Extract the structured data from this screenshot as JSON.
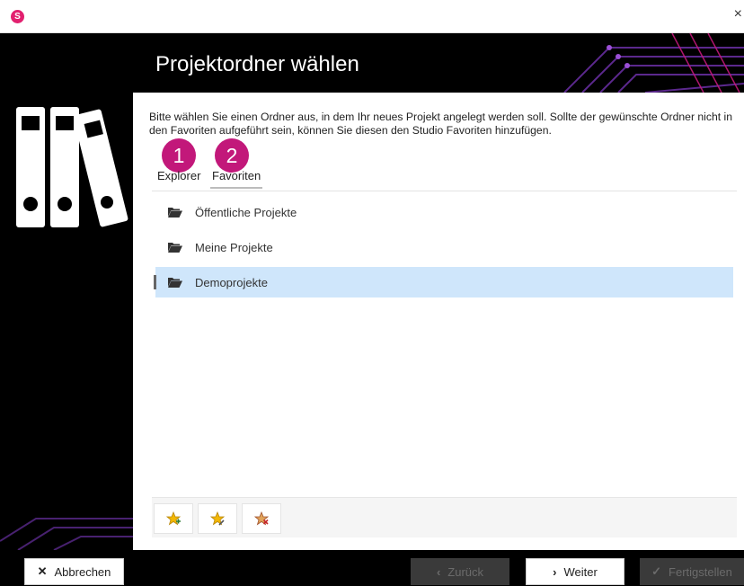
{
  "titlebar": {
    "close_glyph": "×"
  },
  "app_logo": {
    "letter": "S",
    "color": "#e2206f"
  },
  "header": {
    "title": "Projektordner wählen"
  },
  "instructions": "Bitte wählen Sie einen Ordner aus, in dem Ihr neues Projekt angelegt werden soll. Sollte der gewünschte Ordner nicht in den Favoriten aufgeführt sein, können Sie diesen den Studio Favoriten hinzufügen.",
  "badges": [
    "1",
    "2"
  ],
  "tabs": [
    {
      "label": "Explorer",
      "active": false
    },
    {
      "label": "Favoriten",
      "active": true
    }
  ],
  "folders": [
    {
      "label": "Öffentliche Projekte",
      "icon": "folder-open-icon",
      "selected": false
    },
    {
      "label": "Meine Projekte",
      "icon": "folder-open-icon",
      "selected": false
    },
    {
      "label": "Demoprojekte",
      "icon": "folder-open-icon",
      "selected": true
    }
  ],
  "star_buttons": [
    {
      "icon": "star-add-icon"
    },
    {
      "icon": "star-edit-icon"
    },
    {
      "icon": "star-remove-icon"
    }
  ],
  "footer": {
    "cancel_label": "Abbrechen",
    "back_label": "Zurück",
    "next_label": "Weiter",
    "finish_label": "Fertigstellen"
  },
  "colors": {
    "accent": "#c2187a",
    "selection": "#cfe6fb",
    "header_bg": "#000000",
    "disabled_button": "#3a3a3a"
  }
}
